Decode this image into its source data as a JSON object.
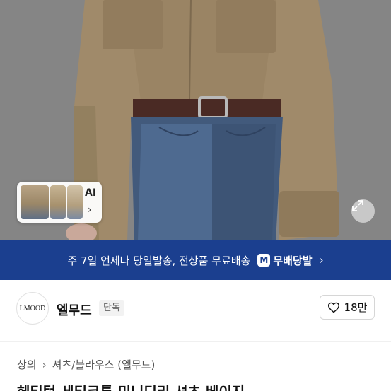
{
  "ai_thumbnails": {
    "label": "AI",
    "chevron": "›"
  },
  "icons": {
    "expand": "expand-diagonal-icon",
    "heart": "heart-outline-icon",
    "chevron": "chevron-right-icon"
  },
  "banner": {
    "message": "주 7일 언제나 당일발송, 전상품 무료배송",
    "badge_icon": "M",
    "badge_label": "무배당발",
    "arrow": "›",
    "bg_color": "#1b3f8f"
  },
  "shop": {
    "logo_text": "LMOOD",
    "name": "엘무드",
    "exclusive_label": "단독",
    "likes": "18만"
  },
  "breadcrumb": {
    "items": [
      "상의",
      "셔츠/블라우스 (엘무드)"
    ],
    "separator": "›"
  },
  "product": {
    "title_clipped": "헤티턴 세티코튼 미니디리 셔츠 베이지"
  }
}
